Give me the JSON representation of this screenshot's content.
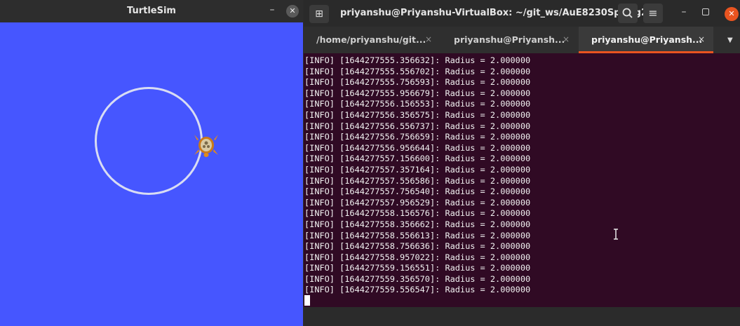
{
  "turtlesim": {
    "title": "TurtleSim",
    "min_glyph": "–",
    "close_glyph": "✕",
    "background_color": "#4656ff",
    "path_color": "#d8dcf3"
  },
  "terminal": {
    "title": "priyanshu@Priyanshu-VirtualBox: ~/git_ws/AuE8230Spring2...",
    "newtab_glyph": "⊞",
    "menu_glyph": "≡",
    "min_glyph": "–",
    "close_glyph": "✕",
    "tabs": [
      {
        "label": "/home/priyanshu/git...",
        "close": "×"
      },
      {
        "label": "priyanshu@Priyansh...",
        "close": "×"
      },
      {
        "label": "priyanshu@Priyansh...",
        "close": "×"
      }
    ],
    "tab_scroll_glyph": "▼",
    "accent_color": "#e95420",
    "log_lines": [
      "[INFO] [1644277555.356632]: Radius = 2.000000",
      "[INFO] [1644277555.556702]: Radius = 2.000000",
      "[INFO] [1644277555.756593]: Radius = 2.000000",
      "[INFO] [1644277555.956679]: Radius = 2.000000",
      "[INFO] [1644277556.156553]: Radius = 2.000000",
      "[INFO] [1644277556.356575]: Radius = 2.000000",
      "[INFO] [1644277556.556737]: Radius = 2.000000",
      "[INFO] [1644277556.756659]: Radius = 2.000000",
      "[INFO] [1644277556.956644]: Radius = 2.000000",
      "[INFO] [1644277557.156600]: Radius = 2.000000",
      "[INFO] [1644277557.357164]: Radius = 2.000000",
      "[INFO] [1644277557.556586]: Radius = 2.000000",
      "[INFO] [1644277557.756540]: Radius = 2.000000",
      "[INFO] [1644277557.956529]: Radius = 2.000000",
      "[INFO] [1644277558.156576]: Radius = 2.000000",
      "[INFO] [1644277558.356662]: Radius = 2.000000",
      "[INFO] [1644277558.556613]: Radius = 2.000000",
      "[INFO] [1644277558.756636]: Radius = 2.000000",
      "[INFO] [1644277558.957022]: Radius = 2.000000",
      "[INFO] [1644277559.156551]: Radius = 2.000000",
      "[INFO] [1644277559.356570]: Radius = 2.000000",
      "[INFO] [1644277559.556547]: Radius = 2.000000"
    ]
  }
}
